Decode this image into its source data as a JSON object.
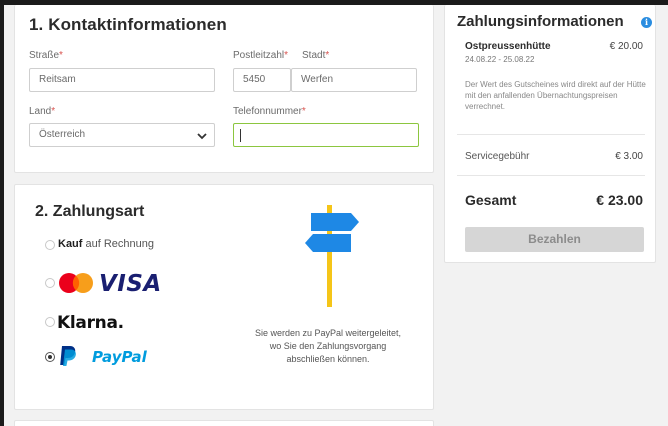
{
  "contact": {
    "title": "1. Kontaktinformationen",
    "street": {
      "label": "Straße",
      "required": "*",
      "value": "Reitsam"
    },
    "zip": {
      "label": "Postleitzahl",
      "required": "*",
      "value": "5450"
    },
    "city": {
      "label": "Stadt",
      "required": "*",
      "value": "Werfen"
    },
    "country": {
      "label": "Land",
      "required": "*",
      "value": "Österreich"
    },
    "phone": {
      "label": "Telefonnummer",
      "required": "*",
      "value": ""
    }
  },
  "payment": {
    "title": "2. Zahlungsart",
    "options": {
      "invoice": {
        "bold": "Kauf",
        "rest": " auf Rechnung"
      },
      "visa": {
        "label": "VISA"
      },
      "klarna": {
        "label": "Klarna."
      },
      "paypal": {
        "label": "PayPal"
      }
    },
    "selected": "paypal",
    "paypal_note": "Sie werden zu PayPal weitergeleitet, wo Sie den Zahlungsvorgang abschließen können."
  },
  "summary": {
    "title": "Zahlungsinformationen",
    "info_icon": "i",
    "item_name": "Ostpreussenhütte",
    "item_price": "€ 20.00",
    "item_dates": "24.08.22 - 25.08.22",
    "item_note": "Der Wert des Gutscheines wird direkt auf der Hütte mit den anfallenden Übernachtungspreisen verrechnet.",
    "fee_label": "Servicegebühr",
    "fee_value": "€ 3.00",
    "total_label": "Gesamt",
    "total_value": "€ 23.00",
    "pay_button": "Bezahlen"
  },
  "colors": {
    "required": "#d9534f",
    "active_border": "#8cc63f",
    "visa_blue": "#1a1f71",
    "paypal_blue": "#009cde",
    "paypal_dark": "#003087",
    "signpost_blue": "#1e88e5",
    "signpost_pole": "#f5c518",
    "info_blue": "#2a8de0"
  },
  "icons": {
    "mastercard": "mastercard-icon",
    "paypal_logo": "paypal-logo-icon",
    "signpost": "signpost-icon",
    "chevron": "chevron-down-icon"
  }
}
